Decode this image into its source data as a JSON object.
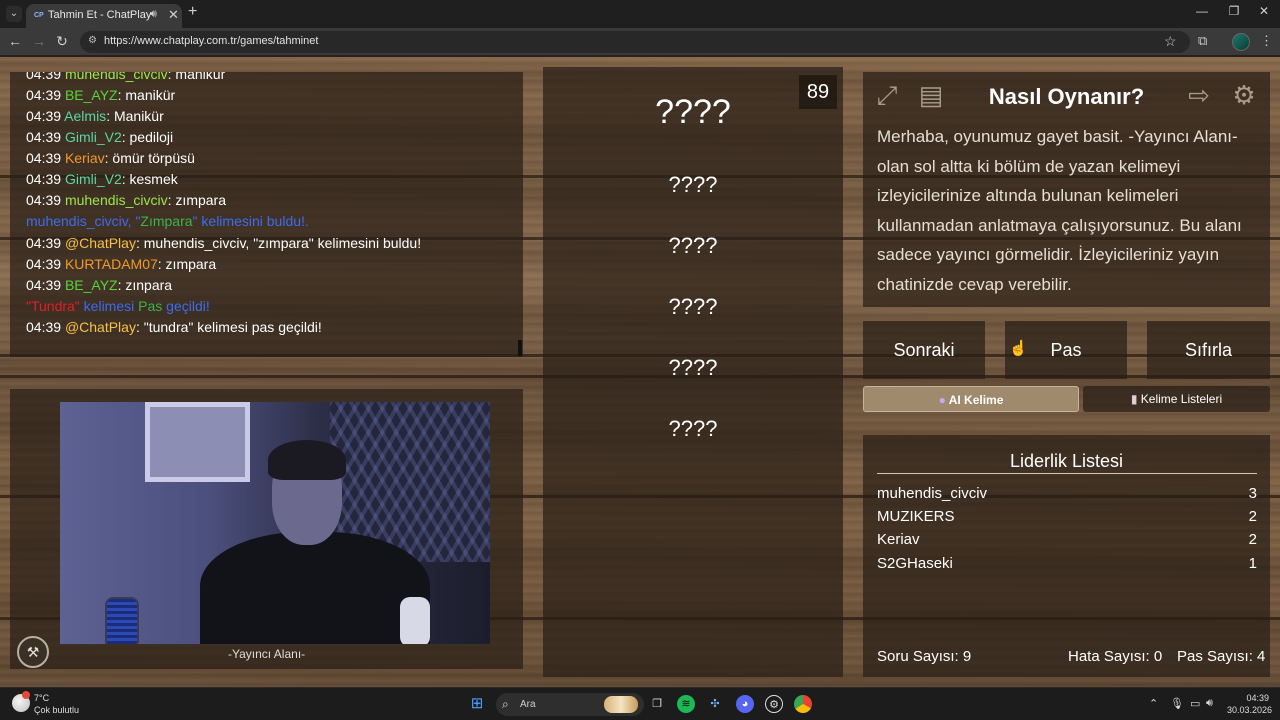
{
  "browser": {
    "tab_title": "Tahmin Et - ChatPlay",
    "tab_favicon": "CP",
    "url": "https://www.chatplay.com.tr/games/tahminet"
  },
  "chat": [
    {
      "time": "04:39",
      "user": "muhendis_civciv",
      "user_color": "lime",
      "text": ": manikür"
    },
    {
      "time": "04:39",
      "user": "BE_AYZ",
      "user_color": "green",
      "text": ": manikür"
    },
    {
      "time": "04:39",
      "user": "Aelmis",
      "user_color": "teal",
      "text": ": Manikür"
    },
    {
      "time": "04:39",
      "user": "Gimli_V2",
      "user_color": "teal",
      "text": ": pediloji"
    },
    {
      "time": "04:39",
      "user": "Keriav",
      "user_color": "orange",
      "text": ": ömür törpüsü"
    },
    {
      "time": "04:39",
      "user": "Gimli_V2",
      "user_color": "teal",
      "text": ": kesmek"
    },
    {
      "time": "04:39",
      "user": "muhendis_civciv",
      "user_color": "lime",
      "text": ": zımpara"
    },
    {
      "system": true,
      "parts": [
        "muhendis_civciv, \"",
        "Zımpara",
        "\" kelimesini buldu!."
      ]
    },
    {
      "time": "04:39",
      "user": "@ChatPlay",
      "user_color": "cp",
      "text": ": muhendis_civciv, \"zımpara\" kelimesini buldu!"
    },
    {
      "time": "04:39",
      "user": "KURTADAM07",
      "user_color": "orange",
      "text": ": zımpara"
    },
    {
      "time": "04:39",
      "user": "BE_AYZ",
      "user_color": "green",
      "text": ": zınpara"
    },
    {
      "system": true,
      "parts": [
        "\"Tundra\"",
        " kelimesi ",
        "Pas",
        " geçildi!"
      ]
    },
    {
      "time": "04:39",
      "user": "@ChatPlay",
      "user_color": "cp",
      "text": ": \"tundra\" kelimesi pas geçildi!"
    }
  ],
  "stream": {
    "label": "-Yayıncı Alanı-"
  },
  "words": {
    "timer": "89",
    "hidden": [
      "????",
      "????",
      "????",
      "????",
      "????",
      "????"
    ]
  },
  "info": {
    "title": "Nasıl Oynanır?",
    "text": "Merhaba, oyunumuz gayet basit. -Yayıncı Alanı- olan sol altta ki bölüm de yazan kelimeyi izleyicilerinize altında bulunan kelimeleri kullanmadan anlatmaya çalışıyorsunuz. Bu alanı sadece yayıncı görmelidir. İzleyicileriniz yayın chatinizde cevap verebilir."
  },
  "controls": {
    "next": "Sonraki",
    "pass": "Pas",
    "reset": "Sıfırla",
    "ai_word": "AI Kelime",
    "word_lists": "Kelime Listeleri"
  },
  "leaderboard": {
    "title": "Liderlik Listesi",
    "rows": [
      {
        "name": "muhendis_civciv",
        "score": "3"
      },
      {
        "name": "MUZIKERS",
        "score": "2"
      },
      {
        "name": "Keriav",
        "score": "2"
      },
      {
        "name": "S2GHaseki",
        "score": "1"
      }
    ]
  },
  "stats": {
    "questions": "Soru Sayısı: 9",
    "errors": "Hata Sayısı: 0",
    "passes": "Pas Sayısı: 4"
  },
  "taskbar": {
    "temp": "7°C",
    "weather": "Çok bulutlu",
    "search_placeholder": "Ara",
    "time": "04:39",
    "date": "30.03.2026"
  },
  "colors": {
    "lime": "#9be84a",
    "green": "#58d33c",
    "teal": "#5bd6a5",
    "orange": "#f09a2b",
    "cp": "#f6c24a",
    "sys_blue": "#3d6cf0",
    "sys_green": "#39b54a",
    "sys_red": "#e0202a"
  }
}
